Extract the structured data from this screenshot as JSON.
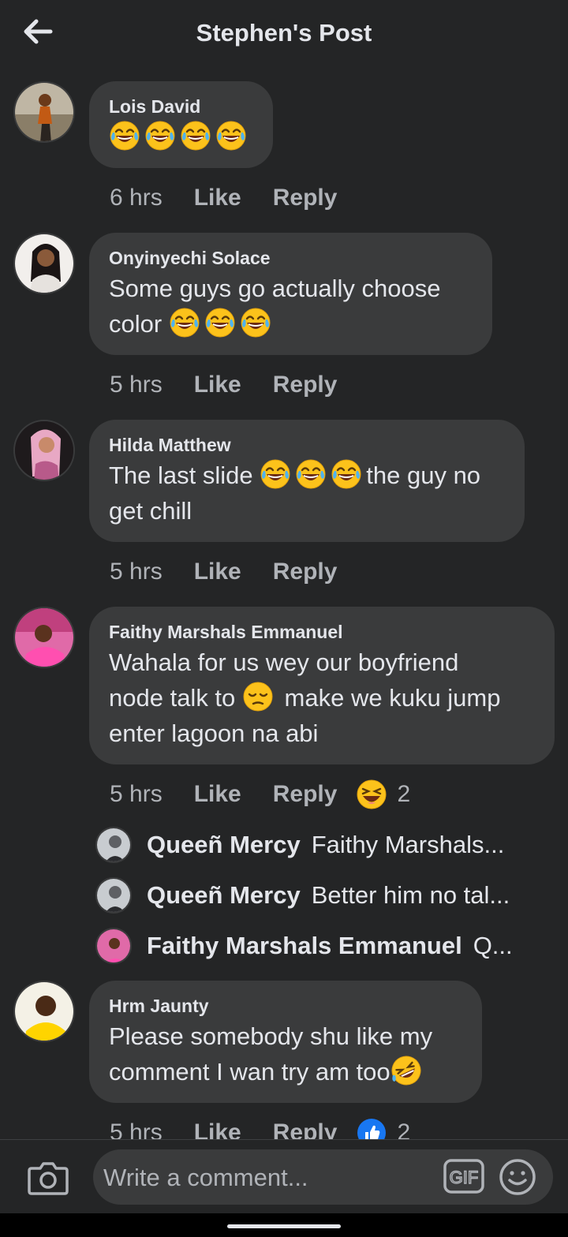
{
  "header": {
    "title": "Stephen's Post",
    "back_icon": "arrow-left-icon"
  },
  "comments": [
    {
      "name": "Lois David",
      "text": "",
      "emoji": [
        "tears-of-joy",
        "tears-of-joy",
        "tears-of-joy",
        "tears-of-joy"
      ],
      "time": "6 hrs",
      "like": "Like",
      "reply": "Reply",
      "avatar_color": "#7a6a55"
    },
    {
      "name": "Onyinyechi Solace",
      "text_line1": "Some guys go actually choose",
      "text_line2": "color",
      "time": "5 hrs",
      "like": "Like",
      "reply": "Reply",
      "avatar_color": "#d9d2cc"
    },
    {
      "name": "Hilda Matthew",
      "text_a": "The last slide",
      "text_b": "the guy no",
      "text_line2": "get chill",
      "time": "5 hrs",
      "like": "Like",
      "reply": "Reply",
      "avatar_color": "#2a2220"
    },
    {
      "name": "Faithy Marshals Emmanuel",
      "text_line1": "Wahala for us wey our boyfriend",
      "text_a": "node talk to",
      "text_b": "make we kuku jump",
      "text_line3": "enter lagoon na abi",
      "time": "5 hrs",
      "like": "Like",
      "reply": "Reply",
      "reaction_count": "2",
      "reaction_icon": "laughing-squint-icon",
      "avatar_color": "#c04a8a"
    },
    {
      "name": "Hrm Jaunty",
      "text_line1": "Please somebody shu like my",
      "text_line2": "comment I wan try am too",
      "time": "5 hrs",
      "like": "Like",
      "reply": "Reply",
      "reaction_count": "2",
      "reaction_icon": "thumbs-up-icon",
      "avatar_color": "#e8c21a"
    }
  ],
  "replies": [
    {
      "name": "Queeñ Mercy",
      "text": "Faithy Marshals...",
      "avatar_color": "#9aa0a6"
    },
    {
      "name": "Queeñ Mercy",
      "text": "Better him no tal...",
      "avatar_color": "#9aa0a6"
    },
    {
      "name": "Faithy Marshals Emmanuel",
      "text": "Q...",
      "avatar_color": "#c04a8a"
    }
  ],
  "composer": {
    "placeholder": "Write a comment...",
    "gif_label": "GIF",
    "camera_icon": "camera-icon",
    "emoji_icon": "smiley-icon"
  },
  "colors": {
    "background": "#242526",
    "bubble": "#3a3b3c",
    "text": "#e4e6eb",
    "secondary": "#b0b3b8",
    "like_blue": "#1877f2"
  }
}
